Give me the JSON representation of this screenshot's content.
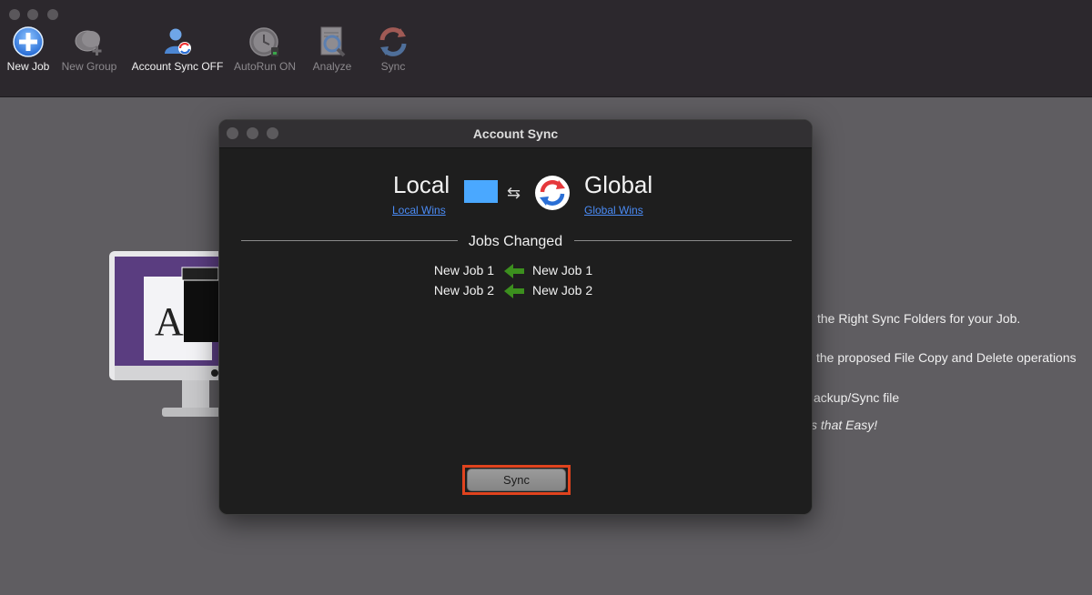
{
  "toolbar": {
    "items": [
      {
        "label": "New Job",
        "icon": "new-job-icon",
        "enabled": true
      },
      {
        "label": "New Group",
        "icon": "new-group-icon",
        "enabled": false
      },
      {
        "label": "Account Sync OFF",
        "icon": "account-sync-icon",
        "enabled": true
      },
      {
        "label": "AutoRun ON",
        "icon": "autorun-clock-icon",
        "enabled": false
      },
      {
        "label": "Analyze",
        "icon": "analyze-icon",
        "enabled": false
      },
      {
        "label": "Sync",
        "icon": "sync-icon",
        "enabled": false
      }
    ]
  },
  "background": {
    "lines": [
      "the Right Sync Folders for your Job.",
      "the proposed File Copy and Delete operations",
      "ackup/Sync file",
      "s that Easy!"
    ]
  },
  "modal": {
    "title": "Account Sync",
    "local": {
      "title": "Local",
      "link": "Local Wins",
      "color": "#4aa8ff"
    },
    "global": {
      "title": "Global",
      "link": "Global Wins"
    },
    "swap_symbol": "⇆",
    "section_title": "Jobs Changed",
    "jobs": [
      {
        "left": "New Job 1",
        "right": "New Job 1",
        "direction": "left"
      },
      {
        "left": "New Job 2",
        "right": "New Job 2",
        "direction": "left"
      }
    ],
    "sync_button": "Sync"
  },
  "colors": {
    "highlight": "#e0431e",
    "link": "#4a8bf5",
    "arrow": "#3c8f1e"
  }
}
